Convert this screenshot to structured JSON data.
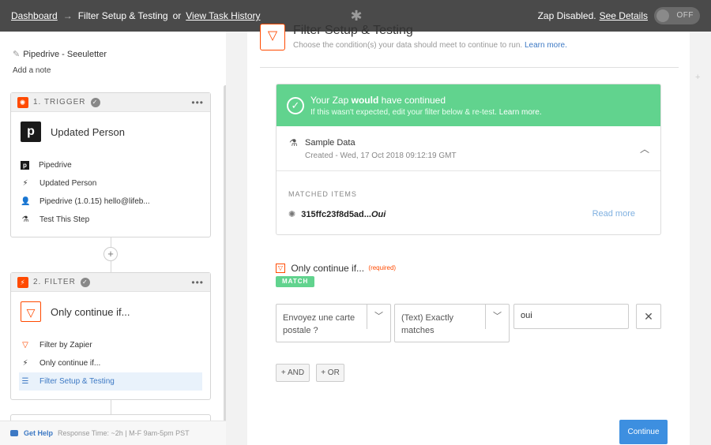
{
  "topbar": {
    "dashboard": "Dashboard",
    "arrow": "→",
    "current": "Filter Setup & Testing",
    "or": "or",
    "history": "View Task History",
    "status": "Zap Disabled.",
    "see_details": "See Details",
    "toggle_label": "OFF"
  },
  "left": {
    "zap_name": "Pipedrive - Seeuletter",
    "add_note": "Add a note",
    "trigger": {
      "head": "1. TRIGGER",
      "app_name": "Updated Person",
      "rows": [
        "Pipedrive",
        "Updated Person",
        "Pipedrive (1.0.15) hello@lifeb...",
        "Test This Step"
      ]
    },
    "filter": {
      "head": "2. FILTER",
      "app_name": "Only continue if...",
      "rows": [
        "Filter by Zapier",
        "Only continue if...",
        "Filter Setup & Testing"
      ]
    },
    "help": {
      "label": "Get Help",
      "response": "Response Time: ~2h | M-F 9am-5pm PST"
    }
  },
  "main": {
    "title": "Filter Setup & Testing",
    "subtitle": "Choose the condition(s) your data should meet to continue to run.",
    "learn_more": "Learn more.",
    "banner": {
      "line1_prefix": "Your Zap",
      "line1_bold": "would",
      "line1_suffix": "have continued",
      "line2": "If this wasn't expected, edit your filter below & re-test.",
      "learn_more": "Learn more."
    },
    "sample": {
      "title": "Sample Data",
      "created": "Created - Wed, 17 Oct 2018 09:12:19 GMT"
    },
    "matched": {
      "header": "MATCHED ITEMS",
      "id": "315ffc23f8d5ad...",
      "value": "Oui",
      "read_more": "Read more"
    },
    "condition": {
      "title": "Only continue if...",
      "required": "(required)",
      "badge": "MATCH",
      "field": "Envoyez une carte postale ?",
      "operator": "(Text) Exactly matches",
      "value": "oui"
    },
    "buttons": {
      "and": "+ AND",
      "or": "+ OR",
      "continue": "Continue"
    }
  },
  "colors": {
    "accent": "#ff4a00",
    "success": "#61d38e",
    "link": "#3d79c4",
    "topbar": "#4a4a4a"
  }
}
